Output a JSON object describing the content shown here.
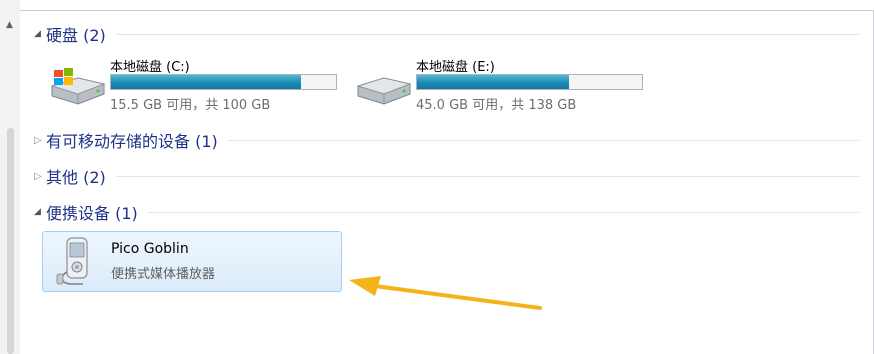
{
  "groups": [
    {
      "title": "硬盘 (2)",
      "expanded": true
    },
    {
      "title": "有可移动存储的设备 (1)",
      "expanded": false
    },
    {
      "title": "其他 (2)",
      "expanded": false
    },
    {
      "title": "便携设备 (1)",
      "expanded": true
    }
  ],
  "drives": [
    {
      "name": "本地磁盘 (C:)",
      "free_text": "15.5 GB 可用，共 100 GB",
      "used_fraction": 0.845,
      "icon": "windows-drive-icon"
    },
    {
      "name": "本地磁盘 (E:)",
      "free_text": "45.0 GB 可用，共 138 GB",
      "used_fraction": 0.674,
      "icon": "hard-drive-icon"
    }
  ],
  "device": {
    "name": "Pico Goblin",
    "type": "便携式媒体播放器",
    "icon": "portable-player-icon"
  },
  "colors": {
    "group_title": "#1e3287",
    "bar_fill": "#1b8ab3",
    "tile_border": "#a9cdef",
    "tile_bg": "#dcebfa",
    "annotation_arrow": "#f5b31b"
  }
}
